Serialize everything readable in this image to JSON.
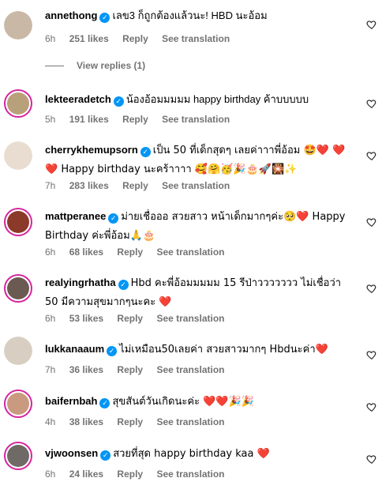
{
  "comments": [
    {
      "username": "annethong",
      "text": "เลข3 ก็ถูกต้องแล้วนะ! HBD นะอ้อม",
      "time": "6h",
      "likes": "251 likes",
      "reply": "Reply",
      "translate": "See translation",
      "view_replies": "View replies (1)",
      "avatar_color": "#c9b8a6",
      "ring": false
    },
    {
      "username": "lekteeradetch",
      "text": "น้องอ้อมมมมม happy birthday ค้าบบบบบ",
      "time": "5h",
      "likes": "191 likes",
      "reply": "Reply",
      "translate": "See translation",
      "avatar_color": "#b8a07a",
      "ring": true
    },
    {
      "username": "cherrykhemupsorn",
      "text": "เป็น 50 ที่เด็กสุดๆ เลยค่าาาพี่อ้อม 🤩❤️ ❤️❤️ Happy birthday นะคร้าาาา 🥰🤗🥳🎉🎂🚀🎇✨",
      "time": "7h",
      "likes": "283 likes",
      "reply": "Reply",
      "translate": "See translation",
      "avatar_color": "#e8ddd0",
      "ring": false
    },
    {
      "username": "mattperanee",
      "text": "ม่ายเชื่อออ สวยสาว หน้าเด็กมากๆค่ะ🥺❤️ Happy Birthday ค่ะพี่อ้อม🙏🎂",
      "time": "6h",
      "likes": "68 likes",
      "reply": "Reply",
      "translate": "See translation",
      "avatar_color": "#8b3a2a",
      "ring": true
    },
    {
      "username": "realyingrhatha",
      "text": "Hbd คะพี่อ้อมมมมม 15 รีป่าววววววว ไม่เชื่อว่า 50 มีความสุขมากๆนะคะ ❤️",
      "time": "6h",
      "likes": "53 likes",
      "reply": "Reply",
      "translate": "See translation",
      "avatar_color": "#6b5a52",
      "ring": true
    },
    {
      "username": "lukkanaaum",
      "text": "ไม่เหมือน50เลยค่า สวยสาวมากๆ Hbdนะค่า❤️",
      "time": "7h",
      "likes": "36 likes",
      "reply": "Reply",
      "translate": "See translation",
      "avatar_color": "#d8cfc2",
      "ring": false
    },
    {
      "username": "baifernbah",
      "text": "สุขสันต์วันเกิดนะค่ะ ❤️❤️🎉🎉",
      "time": "4h",
      "likes": "38 likes",
      "reply": "Reply",
      "translate": "See translation",
      "avatar_color": "#c99a7f",
      "ring": true
    },
    {
      "username": "vjwoonsen",
      "text": "สวยที่สุด happy birthday kaa ❤️",
      "time": "6h",
      "likes": "24 likes",
      "reply": "Reply",
      "translate": "See translation",
      "avatar_color": "#6f6a66",
      "ring": true
    }
  ]
}
